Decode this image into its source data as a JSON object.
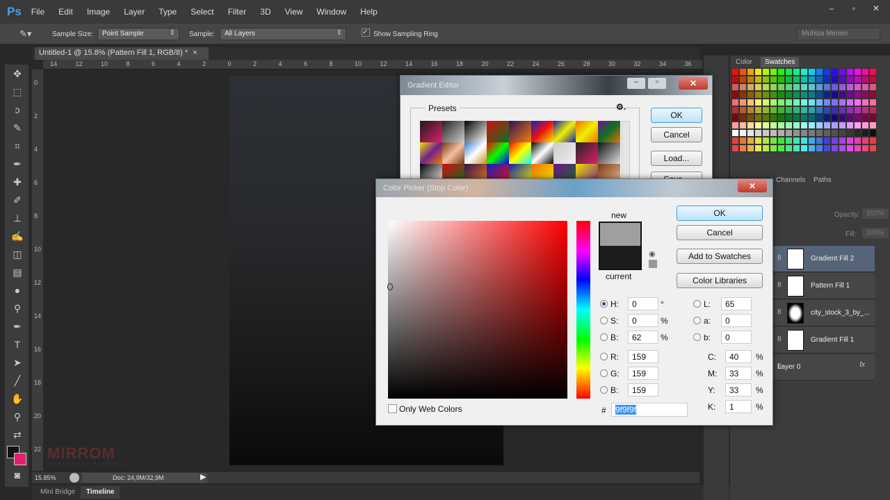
{
  "app": {
    "logo": "Ps",
    "menu": [
      "File",
      "Edit",
      "Image",
      "Layer",
      "Type",
      "Select",
      "Filter",
      "3D",
      "View",
      "Window",
      "Help"
    ],
    "window_controls": [
      "–",
      "▫",
      "✕"
    ]
  },
  "options": {
    "sample_size_label": "Sample Size:",
    "sample_size_value": "Point Sample",
    "sample_label": "Sample:",
    "sample_value": "All Layers",
    "show_ring_label": "Show Sampling Ring",
    "show_ring_checked": true,
    "workspace": "Muhiza Mirrom"
  },
  "document": {
    "tab_title": "Untitled-1 @ 15.8% (Pattern Fill 1, RGB/8) *",
    "close": "×",
    "ruler_h": [
      "14",
      "12",
      "10",
      "8",
      "6",
      "4",
      "2",
      "0",
      "2",
      "4",
      "6",
      "8",
      "10",
      "12",
      "14",
      "16",
      "18",
      "20",
      "22",
      "24",
      "26",
      "28",
      "30",
      "32",
      "34",
      "36"
    ],
    "ruler_v": [
      "0",
      "2",
      "4",
      "6",
      "8",
      "10",
      "12",
      "14",
      "16",
      "18",
      "20",
      "22"
    ]
  },
  "status": {
    "zoom": "15.85%",
    "doc": "Doc: 24,9M/32,9M"
  },
  "bottom_tabs": [
    "Mini Bridge",
    "Timeline"
  ],
  "watermark": {
    "title": "MIRROM",
    "subtitle": "PHOTOSHOP TUTORIAL"
  },
  "panels": {
    "color_tabs": [
      "Color",
      "Swatches"
    ],
    "layer_tabs": [
      "Channels",
      "Paths"
    ],
    "opacity_label": "Opacity:",
    "opacity_value": "100%",
    "fill_label": "Fill:",
    "fill_value": "100%",
    "layers": [
      {
        "name": "Gradient Fill 2",
        "selected": true
      },
      {
        "name": "Pattern Fill 1"
      },
      {
        "name": "city_stock_3_by_..."
      },
      {
        "name": "Gradient Fill 1"
      },
      {
        "name": "Layer 0"
      }
    ],
    "fx": "fx"
  },
  "gradient_editor": {
    "title": "Gradient Editor",
    "presets_label": "Presets",
    "ok": "OK",
    "cancel": "Cancel",
    "load": "Load...",
    "save": "Save...",
    "presets": [
      [
        "#1a1a1a",
        "#e0206a"
      ],
      [
        "#222",
        "#ccc"
      ],
      [
        "#000",
        "#fff"
      ],
      [
        "#d01010",
        "#107020"
      ],
      [
        "#301050",
        "#f08010"
      ],
      [
        "#1020c0",
        "#f01010",
        "#f0f000"
      ],
      [
        "#1020b0",
        "#f0f000",
        "#1020b0"
      ],
      [
        "#f07000",
        "#f0f000",
        "#f07000"
      ],
      [
        "#701090",
        "#107020",
        "#f07000"
      ],
      [
        "#f0e000",
        "#702090",
        "#f08000"
      ],
      [
        "#7a3a10",
        "#f0c0a0",
        "#7a3a10"
      ],
      [
        "#3080d0",
        "#fff",
        "#c09020"
      ],
      [
        "#f00",
        "#0f0",
        "#00f"
      ],
      [
        "#f00",
        "#ff0",
        "#0ff"
      ],
      [
        "#000",
        "#fff",
        "#000"
      ],
      [
        "#ccc",
        "#eee"
      ],
      [
        "#222",
        "#e0206a"
      ],
      [
        "#111",
        "#ddd"
      ],
      [
        "#000",
        "#fff"
      ],
      [
        "#d01010",
        "#107020"
      ],
      [
        "#301050",
        "#f08010"
      ],
      [
        "#1020c0",
        "#f01010"
      ],
      [
        "#1020b0",
        "#f0f000"
      ],
      [
        "#f07000",
        "#f0f000"
      ],
      [
        "#701090",
        "#107020"
      ],
      [
        "#f0e000",
        "#702090"
      ],
      [
        "#7a3a10",
        "#f0c0a0"
      ]
    ]
  },
  "color_picker": {
    "title": "Color Picker (Stop Color)",
    "ok": "OK",
    "cancel": "Cancel",
    "add_to_swatches": "Add to Swatches",
    "color_libraries": "Color Libraries",
    "new_label": "new",
    "current_label": "current",
    "new_color": "#9f9f9f",
    "current_color": "#1c1c1c",
    "hue_color": "#ff0000",
    "only_web_colors": "Only Web Colors",
    "only_web_checked": false,
    "hsb": [
      {
        "label": "H:",
        "value": "0",
        "unit": "°",
        "selected": true
      },
      {
        "label": "S:",
        "value": "0",
        "unit": "%"
      },
      {
        "label": "B:",
        "value": "62",
        "unit": "%"
      }
    ],
    "rgb": [
      {
        "label": "R:",
        "value": "159"
      },
      {
        "label": "G:",
        "value": "159"
      },
      {
        "label": "B:",
        "value": "159"
      }
    ],
    "lab": [
      {
        "label": "L:",
        "value": "65"
      },
      {
        "label": "a:",
        "value": "0"
      },
      {
        "label": "b:",
        "value": "0"
      }
    ],
    "cmyk": [
      {
        "label": "C:",
        "value": "40",
        "unit": "%"
      },
      {
        "label": "M:",
        "value": "33",
        "unit": "%"
      },
      {
        "label": "Y:",
        "value": "33",
        "unit": "%"
      },
      {
        "label": "K:",
        "value": "1",
        "unit": "%"
      }
    ],
    "hex_label": "#",
    "hex": "9f9f9f"
  },
  "colors": {
    "foreground": "#111111",
    "background": "#e0206a"
  }
}
